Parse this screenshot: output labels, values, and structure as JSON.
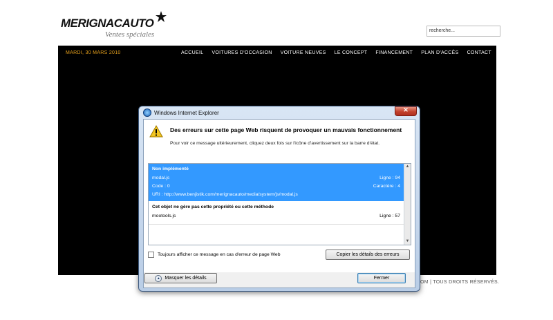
{
  "site": {
    "logo_main": "MERIGNACAUTO",
    "logo_sub": "Ventes spéciales",
    "search_placeholder": "recherche...",
    "date": "MARDI, 30 MARS 2010",
    "nav": [
      "ACCUEIL",
      "VOITURES D'OCCASION",
      "VOITURE NEUVES",
      "LE CONCEPT",
      "FINANCEMENT",
      "PLAN D'ACCÈS",
      "CONTACT"
    ],
    "footer": "OM | TOUS DROITS RÉSERVÉS.",
    "accent_color": "#e8a21c"
  },
  "dialog": {
    "title": "Windows Internet Explorer",
    "heading": "Des erreurs sur cette page Web risquent de provoquer un mauvais fonctionnement",
    "subtext": "Pour voir ce message ultérieurement, cliquez deux fois sur l'icône d'avertissement sur la barre d'état.",
    "errors": [
      {
        "title": "Non implémenté",
        "file": "modal.js",
        "line": "Ligne : 94",
        "code": "Code : 0",
        "char": "Caractère : 4",
        "uri": "URI : http://www.benjistik.com/merignacauto/media/system/js/modal.js"
      },
      {
        "title": "Cet objet ne gère pas cette propriété ou cette méthode",
        "file": "mootools.js",
        "line": "Ligne : 57"
      }
    ],
    "checkbox_label": "Toujours afficher ce message en cas d'erreur de page Web",
    "copy_button": "Copier les détails des erreurs",
    "hide_button": "Masquer les détails",
    "close_button": "Fermer",
    "selection_color": "#3399ff"
  }
}
